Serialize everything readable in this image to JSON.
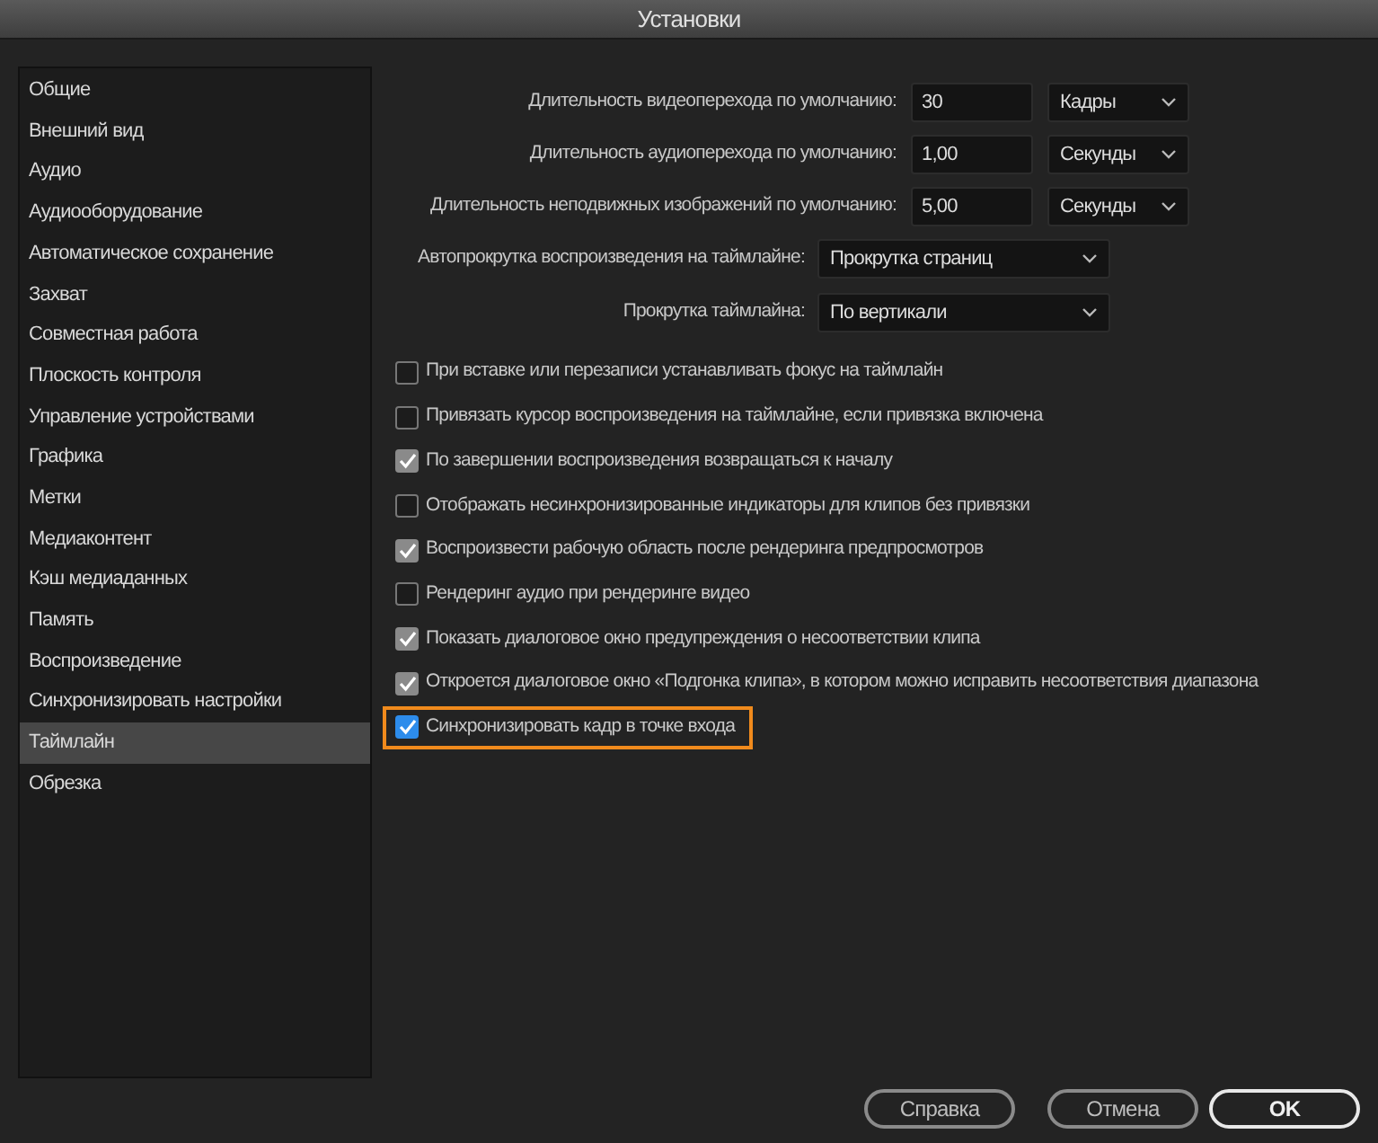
{
  "window": {
    "title": "Установки"
  },
  "sidebar": {
    "items": [
      {
        "label": "Общие",
        "selected": false
      },
      {
        "label": "Внешний вид",
        "selected": false
      },
      {
        "label": "Аудио",
        "selected": false
      },
      {
        "label": "Аудиооборудование",
        "selected": false
      },
      {
        "label": "Автоматическое сохранение",
        "selected": false
      },
      {
        "label": "Захват",
        "selected": false
      },
      {
        "label": "Совместная работа",
        "selected": false
      },
      {
        "label": "Плоскость контроля",
        "selected": false
      },
      {
        "label": "Управление устройствами",
        "selected": false
      },
      {
        "label": "Графика",
        "selected": false
      },
      {
        "label": "Метки",
        "selected": false
      },
      {
        "label": "Медиаконтент",
        "selected": false
      },
      {
        "label": "Кэш медиаданных",
        "selected": false
      },
      {
        "label": "Память",
        "selected": false
      },
      {
        "label": "Воспроизведение",
        "selected": false
      },
      {
        "label": "Синхронизировать настройки",
        "selected": false
      },
      {
        "label": "Таймлайн",
        "selected": true
      },
      {
        "label": "Обрезка",
        "selected": false
      }
    ]
  },
  "durations": [
    {
      "label": "Длительность видеоперехода по умолчанию:",
      "value": "30",
      "unit": "Кадры"
    },
    {
      "label": "Длительность аудиоперехода по умолчанию:",
      "value": "1,00",
      "unit": "Секунды"
    },
    {
      "label": "Длительность неподвижных изображений по умолчанию:",
      "value": "5,00",
      "unit": "Секунды"
    }
  ],
  "dropdowns": [
    {
      "label": "Автопрокрутка воспроизведения на таймлайне:",
      "value": "Прокрутка страниц"
    },
    {
      "label": "Прокрутка таймлайна:",
      "value": "По вертикали"
    }
  ],
  "checkboxes": [
    {
      "label": "При вставке или перезаписи устанавливать фокус на таймлайн",
      "checked": false,
      "highlighted": false
    },
    {
      "label": "Привязать курсор воспроизведения на таймлайне, если привязка включена",
      "checked": false,
      "highlighted": false
    },
    {
      "label": "По завершении воспроизведения возвращаться к началу",
      "checked": true,
      "highlighted": false
    },
    {
      "label": "Отображать несинхронизированные индикаторы для клипов без привязки",
      "checked": false,
      "highlighted": false
    },
    {
      "label": "Воспроизвести рабочую область после рендеринга предпросмотров",
      "checked": true,
      "highlighted": false
    },
    {
      "label": "Рендеринг аудио при рендеринге видео",
      "checked": false,
      "highlighted": false
    },
    {
      "label": "Показать диалоговое окно предупреждения о несоответствии клипа",
      "checked": true,
      "highlighted": false
    },
    {
      "label": "Откроется диалоговое окно «Подгонка клипа», в котором можно исправить несоответствия диапазона",
      "checked": true,
      "highlighted": false
    },
    {
      "label": "Синхронизировать кадр в точке входа",
      "checked": true,
      "highlighted": true
    }
  ],
  "buttons": [
    {
      "label": "Справка",
      "kind": "secondary"
    },
    {
      "label": "Отмена",
      "kind": "secondary"
    },
    {
      "label": "OK",
      "kind": "primary"
    }
  ]
}
